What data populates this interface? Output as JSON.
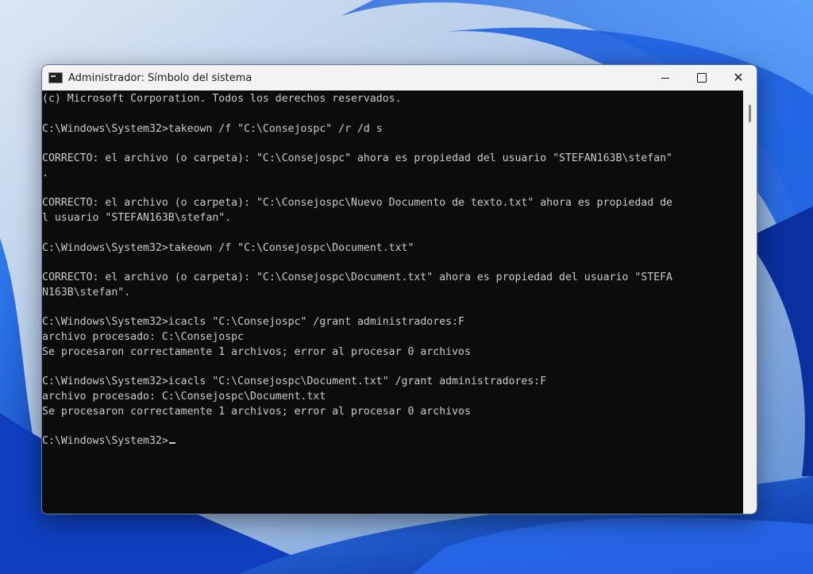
{
  "window": {
    "title": "Administrador: Símbolo del sistema",
    "icon": "cmd-icon",
    "controls": [
      "minimize-icon",
      "maximize-icon",
      "close-icon"
    ]
  },
  "console": {
    "lines": [
      "(c) Microsoft Corporation. Todos los derechos reservados.",
      "",
      "C:\\Windows\\System32>takeown /f \"C:\\Consejospc\" /r /d s",
      "",
      "CORRECTO: el archivo (o carpeta): \"C:\\Consejospc\" ahora es propiedad del usuario \"STEFAN163B\\stefan\"",
      ".",
      "",
      "CORRECTO: el archivo (o carpeta): \"C:\\Consejospc\\Nuevo Documento de texto.txt\" ahora es propiedad de",
      "l usuario \"STEFAN163B\\stefan\".",
      "",
      "C:\\Windows\\System32>takeown /f \"C:\\Consejospc\\Document.txt\"",
      "",
      "CORRECTO: el archivo (o carpeta): \"C:\\Consejospc\\Document.txt\" ahora es propiedad del usuario \"STEFA",
      "N163B\\stefan\".",
      "",
      "C:\\Windows\\System32>icacls \"C:\\Consejospc\" /grant administradores:F",
      "archivo procesado: C:\\Consejospc",
      "Se procesaron correctamente 1 archivos; error al procesar 0 archivos",
      "",
      "C:\\Windows\\System32>icacls \"C:\\Consejospc\\Document.txt\" /grant administradores:F",
      "archivo procesado: C:\\Consejospc\\Document.txt",
      "Se procesaron correctamente 1 archivos; error al procesar 0 archivos",
      "",
      "C:\\Windows\\System32>"
    ]
  },
  "colors": {
    "console_bg": "#0c0c0c",
    "console_fg": "#cccccc",
    "titlebar_bg": "#f3f3f3",
    "wallpaper_accent": "#1b5fd6"
  }
}
